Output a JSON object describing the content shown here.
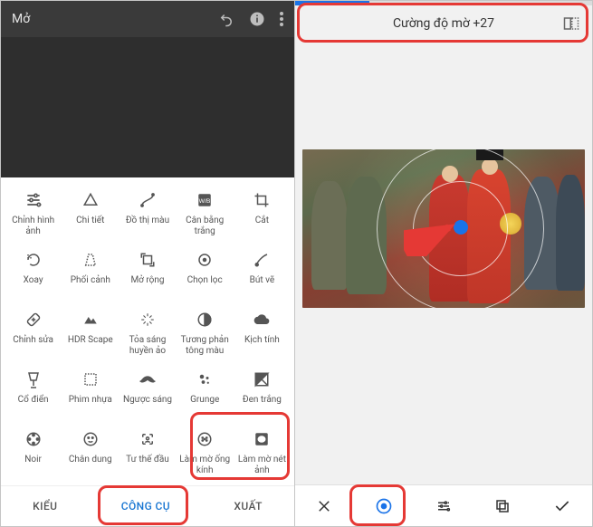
{
  "left": {
    "header": {
      "title": "Mở"
    },
    "tools": [
      {
        "label": "Chỉnh hình ảnh"
      },
      {
        "label": "Chi tiết"
      },
      {
        "label": "Đồ thị màu"
      },
      {
        "label": "Cân bằng trắng"
      },
      {
        "label": "Cắt"
      },
      {
        "label": "Xoay"
      },
      {
        "label": "Phối cảnh"
      },
      {
        "label": "Mở rộng"
      },
      {
        "label": "Chọn lọc"
      },
      {
        "label": "Bút vẽ"
      },
      {
        "label": "Chỉnh sửa"
      },
      {
        "label": "HDR Scape"
      },
      {
        "label": "Tỏa sáng huyền ảo"
      },
      {
        "label": "Tương phản tông màu"
      },
      {
        "label": "Kịch tính"
      },
      {
        "label": "Cổ điển"
      },
      {
        "label": "Phim nhựa"
      },
      {
        "label": "Ngược sáng"
      },
      {
        "label": "Grunge"
      },
      {
        "label": "Đen trắng"
      },
      {
        "label": "Noir"
      },
      {
        "label": "Chân dung"
      },
      {
        "label": "Tư thế đầu"
      },
      {
        "label": "Làm mờ ống kính"
      },
      {
        "label": "Làm mờ nét ảnh"
      }
    ],
    "tabs": {
      "styles": "KIỂU",
      "tools": "CÔNG CỤ",
      "export": "XUẤT"
    }
  },
  "right": {
    "strength_label": "Cường độ mờ +27"
  }
}
